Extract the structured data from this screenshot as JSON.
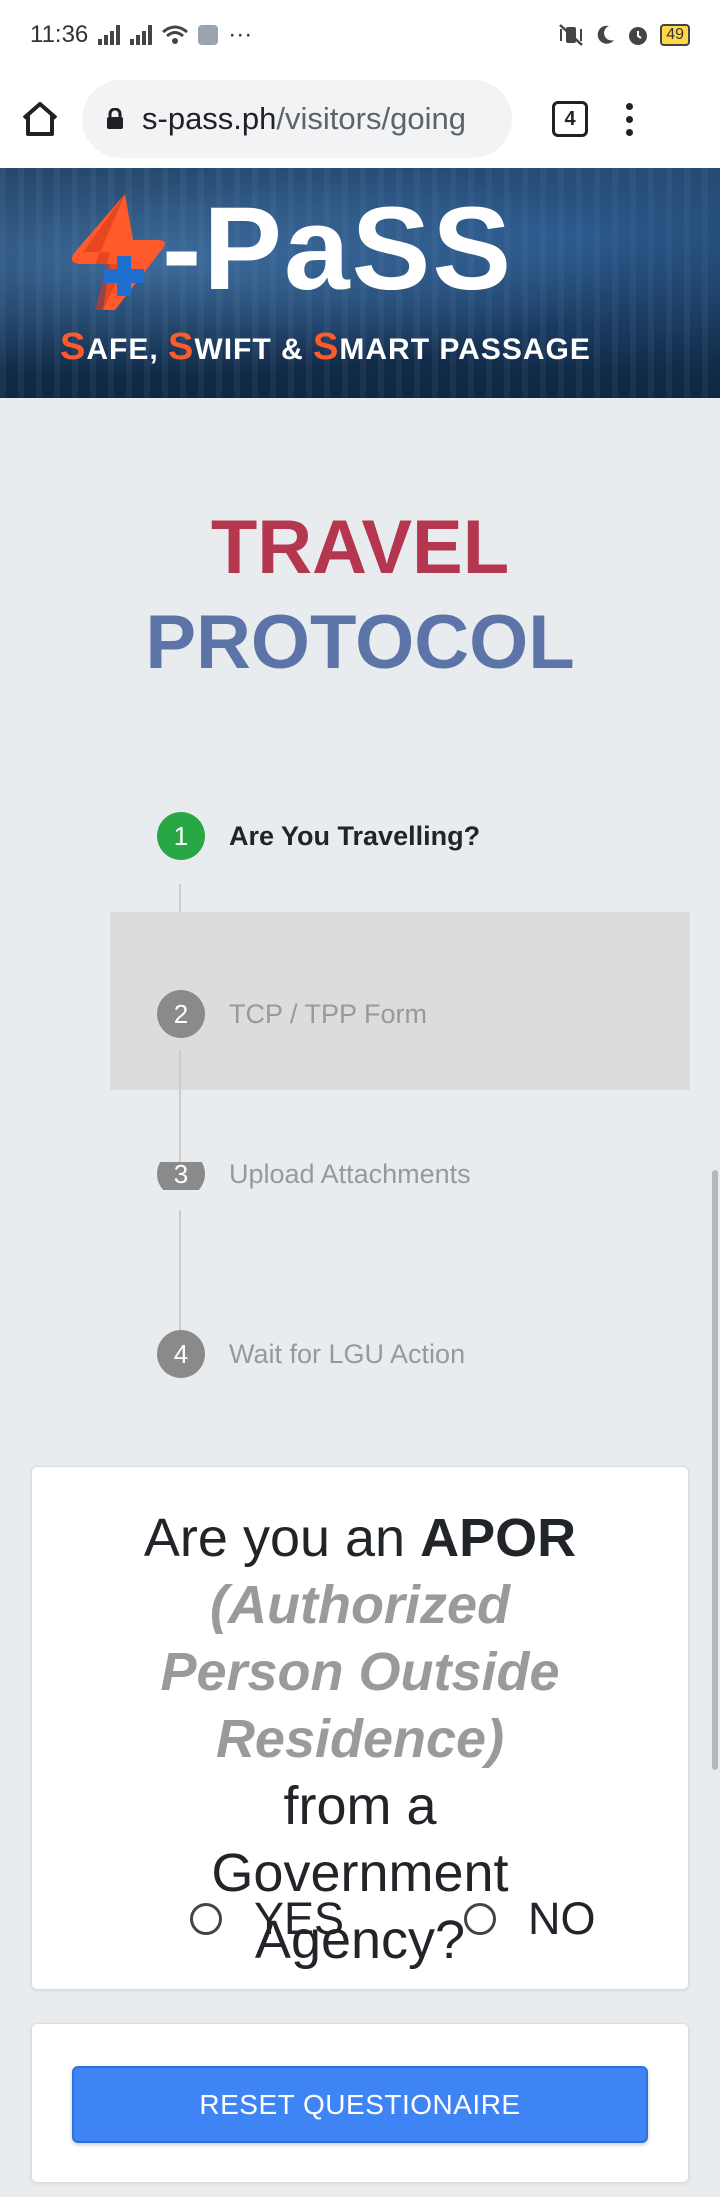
{
  "status_bar": {
    "time": "11:36",
    "extra": "···",
    "battery": "49"
  },
  "browser": {
    "url_domain": "s-pass.ph",
    "url_path": "/visitors/going",
    "tab_count": "4"
  },
  "banner": {
    "title": "-PaSS",
    "tagline": [
      {
        "text": "S",
        "accent": true
      },
      {
        "text": "AFE, ",
        "accent": false
      },
      {
        "text": "S",
        "accent": true
      },
      {
        "text": "WIFT & ",
        "accent": false
      },
      {
        "text": "S",
        "accent": true
      },
      {
        "text": "MART PASSAGE",
        "accent": false
      }
    ]
  },
  "heading": {
    "line1": "TRAVEL",
    "line2": "PROTOCOL"
  },
  "stepper": {
    "steps": [
      {
        "number": "1",
        "label": "Are You Travelling?"
      },
      {
        "number": "2",
        "label": "TCP / TPP Form"
      },
      {
        "number": "3",
        "label": "Upload Attachments"
      },
      {
        "number": "4",
        "label": "Wait for LGU Action"
      }
    ]
  },
  "question": {
    "part1": "Are you an ",
    "part2": "APOR",
    "part3": "(Authorized Person Outside Residence)",
    "part4": "from a Government Agency?",
    "options": [
      "YES",
      "NO"
    ]
  },
  "reset_button": "RESET QUESTIONAIRE",
  "colors": {
    "travel_red": "#b5374f",
    "protocol_blue": "#5d74a8",
    "step_active_green": "#28a745",
    "step_inactive_gray": "#8a8a8a",
    "button_blue": "#3f84f5",
    "logo_orange": "#ff5a2c"
  }
}
